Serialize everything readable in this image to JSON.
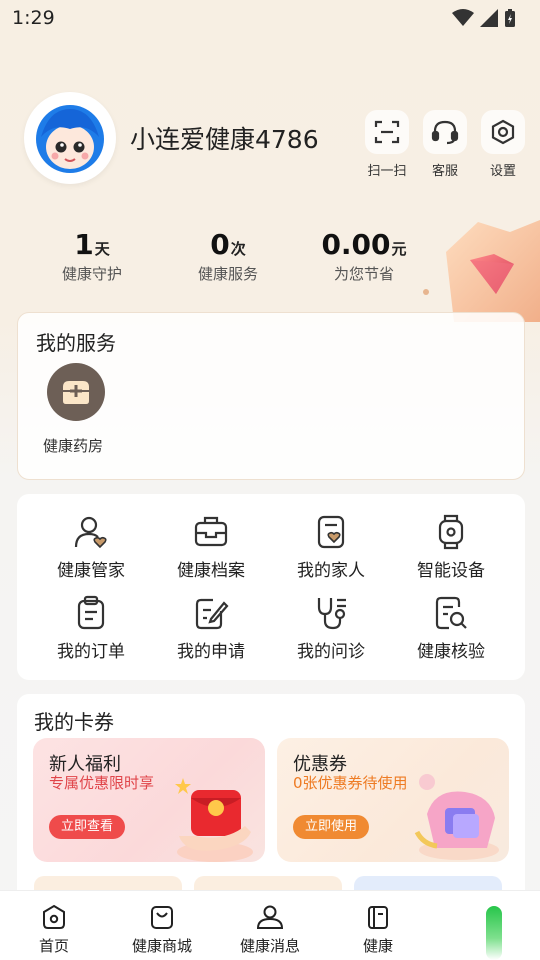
{
  "status_bar": {
    "time": "1:29"
  },
  "profile": {
    "username": "小连爱健康4786"
  },
  "top_actions": [
    {
      "label": "扫一扫",
      "icon": "scan-icon"
    },
    {
      "label": "客服",
      "icon": "headset-icon"
    },
    {
      "label": "设置",
      "icon": "settings-icon"
    }
  ],
  "stats": [
    {
      "value": "1",
      "unit": "天",
      "label": "健康守护"
    },
    {
      "value": "0",
      "unit": "次",
      "label": "健康服务"
    },
    {
      "value": "0.00",
      "unit": "元",
      "label": "为您节省"
    }
  ],
  "my_services": {
    "title": "我的服务",
    "items": [
      {
        "label": "健康药房",
        "icon": "pharmacy-icon"
      }
    ]
  },
  "grid": [
    {
      "label": "健康管家",
      "icon": "user-heart-icon"
    },
    {
      "label": "健康档案",
      "icon": "health-file-icon"
    },
    {
      "label": "我的家人",
      "icon": "family-icon"
    },
    {
      "label": "智能设备",
      "icon": "smartwatch-icon"
    },
    {
      "label": "我的订单",
      "icon": "order-icon"
    },
    {
      "label": "我的申请",
      "icon": "application-icon"
    },
    {
      "label": "我的问诊",
      "icon": "stethoscope-icon"
    },
    {
      "label": "健康核验",
      "icon": "verify-doc-icon"
    }
  ],
  "cards": {
    "title": "我的卡券",
    "new_user": {
      "title": "新人福利",
      "subtitle": "专属优惠限时享",
      "button": "立即查看"
    },
    "coupon": {
      "title": "优惠券",
      "subtitle": "0张优惠券待使用",
      "button": "立即使用"
    }
  },
  "tabbar": [
    {
      "label": "首页",
      "icon": "home-icon"
    },
    {
      "label": "健康商城",
      "icon": "shopping-bag-icon"
    },
    {
      "label": "健康消息",
      "icon": "message-user-icon"
    },
    {
      "label": "健康",
      "icon": "health-book-icon"
    }
  ],
  "colors": {
    "accent_red": "#ef4b4b",
    "accent_orange": "#f08a32",
    "service_icon_bg": "#6d5f56"
  }
}
